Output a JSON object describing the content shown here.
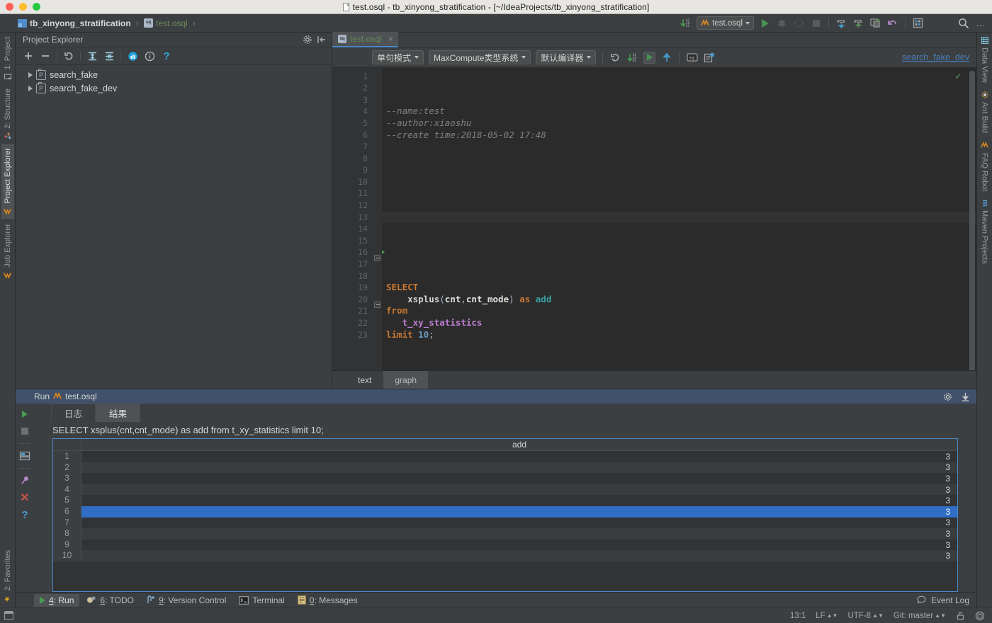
{
  "window": {
    "title": "test.osql - tb_xinyong_stratification - [~/IdeaProjects/tb_xinyong_stratification]"
  },
  "navbar": {
    "crumbs": [
      {
        "label": "tb_xinyong_stratification",
        "icon": "module-icon"
      },
      {
        "label": "test.osql",
        "icon": "osql-file-icon"
      }
    ],
    "separator": "›",
    "run_config": {
      "label": "test.osql",
      "icon": "osql-file-icon"
    },
    "icons": [
      "update-project-icon",
      "run-icon",
      "debug-icon",
      "coverage-icon",
      "stop-icon",
      "vcs-update-icon",
      "vcs-commit-icon",
      "vcs-history-icon",
      "undo-icon",
      "maxcompute-icon",
      "search-icon",
      "more-icon"
    ]
  },
  "left_strip": {
    "top": [
      {
        "label": "1: Project",
        "icon": "project-icon",
        "selected": false
      },
      {
        "label": "2: Structure",
        "icon": "structure-icon",
        "selected": false
      },
      {
        "label": "Project Explorer",
        "icon": "odps-icon",
        "selected": true
      },
      {
        "label": "Job Explorer",
        "icon": "odps-icon",
        "selected": false
      }
    ],
    "bottom": [
      {
        "label": "2: Favorites",
        "icon": "star-icon",
        "selected": false
      }
    ]
  },
  "right_strip": {
    "items": [
      {
        "label": "Data View",
        "icon": "grid-icon"
      },
      {
        "label": "Ant Build",
        "icon": "ant-icon"
      },
      {
        "label": "FAQ Robot",
        "icon": "odps-icon"
      },
      {
        "label": "Maven Projects",
        "icon": "maven-icon"
      }
    ]
  },
  "explorer": {
    "title": "Project Explorer",
    "header_icons": [
      "gear-icon",
      "collapse-panel-icon"
    ],
    "toolbar_icons": [
      "add-icon",
      "remove-icon",
      "refresh-icon",
      "expand-all-icon",
      "collapse-all-icon",
      "chart-icon",
      "info-icon",
      "help-icon"
    ],
    "tree": [
      {
        "label": "search_fake",
        "icon": "project-node-icon",
        "expanded": false
      },
      {
        "label": "search_fake_dev",
        "icon": "project-node-icon",
        "expanded": false
      }
    ]
  },
  "editor": {
    "tab": {
      "label": "test.osql",
      "close": "×",
      "icon": "osql-file-icon"
    },
    "toolbar": {
      "mode_select": "单句模式",
      "type_system_select": "MaxCompute类型系统",
      "compiler_select": "默认编译器",
      "icons": [
        "sync-icon",
        "download-icon",
        "run-icon",
        "upload-icon",
        "sql-console-icon",
        "new-query-icon"
      ]
    },
    "project_link": "search_fake_dev",
    "line_count": 23,
    "lines": [
      {
        "n": 1,
        "tokens": [
          {
            "t": "--name:test",
            "c": "cm"
          }
        ]
      },
      {
        "n": 2,
        "tokens": [
          {
            "t": "--author:xiaoshu",
            "c": "cm"
          }
        ]
      },
      {
        "n": 3,
        "tokens": [
          {
            "t": "--create time:2018-05-02 17:48",
            "c": "cm"
          }
        ]
      },
      {
        "n": 4,
        "tokens": []
      },
      {
        "n": 5,
        "tokens": []
      },
      {
        "n": 6,
        "tokens": []
      },
      {
        "n": 7,
        "tokens": []
      },
      {
        "n": 8,
        "tokens": []
      },
      {
        "n": 9,
        "tokens": []
      },
      {
        "n": 10,
        "tokens": []
      },
      {
        "n": 11,
        "tokens": []
      },
      {
        "n": 12,
        "tokens": []
      },
      {
        "n": 13,
        "tokens": []
      },
      {
        "n": 14,
        "tokens": []
      },
      {
        "n": 15,
        "tokens": []
      },
      {
        "n": 16,
        "tokens": [
          {
            "t": "SELECT",
            "c": "kw"
          }
        ]
      },
      {
        "n": 17,
        "tokens": [
          {
            "t": "    ",
            "c": "pnc"
          },
          {
            "t": "xsplus",
            "c": "fn"
          },
          {
            "t": "(",
            "c": "pnc"
          },
          {
            "t": "cnt",
            "c": "idn"
          },
          {
            "t": ",",
            "c": "pnc"
          },
          {
            "t": "cnt_mode",
            "c": "idn"
          },
          {
            "t": ")",
            "c": "pnc"
          },
          {
            "t": " ",
            "c": "pnc"
          },
          {
            "t": "as",
            "c": "kw"
          },
          {
            "t": " ",
            "c": "pnc"
          },
          {
            "t": "add",
            "c": "al"
          }
        ]
      },
      {
        "n": 18,
        "tokens": [
          {
            "t": "from",
            "c": "kw"
          }
        ]
      },
      {
        "n": 19,
        "tokens": [
          {
            "t": "   ",
            "c": "pnc"
          },
          {
            "t": "t_xy_statistics",
            "c": "tbl"
          }
        ]
      },
      {
        "n": 20,
        "tokens": [
          {
            "t": "limit",
            "c": "kw"
          },
          {
            "t": " ",
            "c": "pnc"
          },
          {
            "t": "10",
            "c": "num"
          },
          {
            "t": ";",
            "c": "pnc"
          }
        ]
      },
      {
        "n": 21,
        "tokens": []
      },
      {
        "n": 22,
        "tokens": []
      },
      {
        "n": 23,
        "tokens": []
      }
    ],
    "bottom_tabs": [
      {
        "label": "text",
        "active": true
      },
      {
        "label": "graph",
        "active": false
      }
    ]
  },
  "run_panel": {
    "header": {
      "label": "Run",
      "file": "test.osql",
      "icon": "odps-icon"
    },
    "header_icons": [
      "settings-icon",
      "export-icon"
    ],
    "toolbar_icons": [
      "run-icon",
      "stop-icon",
      "print-icon",
      "pin-icon",
      "close-icon",
      "help-icon"
    ],
    "tabs": [
      {
        "label": "日志",
        "active": false
      },
      {
        "label": "结果",
        "active": true
      }
    ],
    "sql_echo": "SELECT    xsplus(cnt,cnt_mode) as add from   t_xy_statistics limit 10;",
    "table": {
      "columns": [
        "add"
      ],
      "selected_row": 6,
      "rows": [
        {
          "index": 1,
          "add": "3"
        },
        {
          "index": 2,
          "add": "3"
        },
        {
          "index": 3,
          "add": "3"
        },
        {
          "index": 4,
          "add": "3"
        },
        {
          "index": 5,
          "add": "3"
        },
        {
          "index": 6,
          "add": "3"
        },
        {
          "index": 7,
          "add": "3"
        },
        {
          "index": 8,
          "add": "3"
        },
        {
          "index": 9,
          "add": "3"
        },
        {
          "index": 10,
          "add": "3"
        }
      ]
    }
  },
  "bottom_bar": {
    "items": [
      {
        "num": "4",
        "label": ": Run",
        "icon": "run-icon",
        "active": true
      },
      {
        "num": "6",
        "label": ": TODO",
        "icon": "todo-icon",
        "active": false
      },
      {
        "num": "9",
        "label": ": Version Control",
        "icon": "vcs-icon",
        "active": false
      },
      {
        "num": "",
        "label": "Terminal",
        "icon": "terminal-icon",
        "active": false
      },
      {
        "num": "0",
        "label": ": Messages",
        "icon": "messages-icon",
        "active": false
      }
    ],
    "event_log": "Event Log"
  },
  "status_bar": {
    "caret": "13:1",
    "line_sep": "LF",
    "encoding": "UTF-8",
    "branch": "Git: master",
    "icons": [
      "lock-icon",
      "inspector-icon"
    ]
  },
  "colors": {
    "accent_blue": "#4a88c7",
    "selection_blue": "#2f6ec4",
    "run_header_blue": "#41516b",
    "green_run": "#499c54",
    "keyword_orange": "#cc7832",
    "table_purple": "#bf7fd2",
    "link_blue": "#4a7ebb",
    "tab_green": "#6a8759"
  }
}
